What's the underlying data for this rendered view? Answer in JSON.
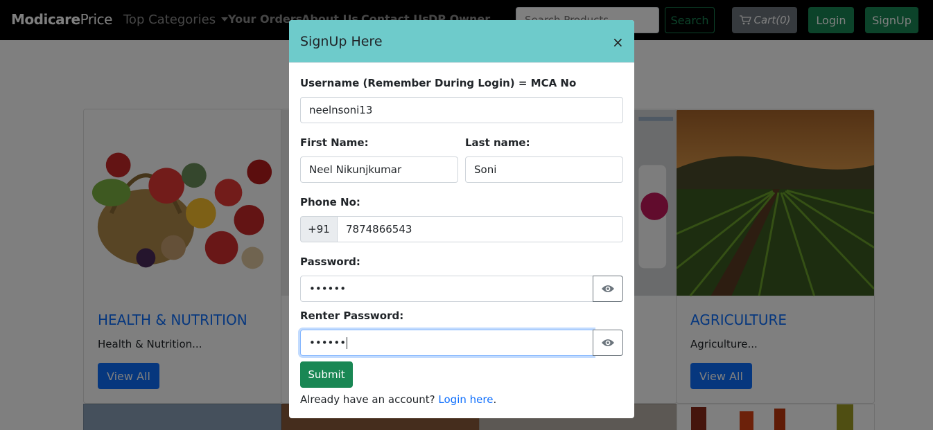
{
  "navbar": {
    "brand_bold": "Modicare",
    "brand_rest": "Price",
    "top_categories": "Top Categories",
    "links": [
      "Your Orders",
      "About Us",
      "Contact Us",
      "DP Owner"
    ],
    "search_placeholder": "Search Products",
    "search_button": "Search",
    "cart_label": "Cart(0)",
    "login_button": "Login",
    "signup_button": "SignUp"
  },
  "cards": [
    {
      "title": "HEALTH & NUTRITION",
      "text": "Health & Nutrition...",
      "button": "View All"
    },
    {
      "title": "AGRICULTURE",
      "text": "Agriculture...",
      "button": "View All"
    }
  ],
  "modal": {
    "title": "SignUp Here",
    "close": "×",
    "username_label": "Username (Remember During Login) = MCA No",
    "username_value": "neelnsoni13",
    "first_name_label": "First Name:",
    "first_name_value": "Neel Nikunjkumar",
    "last_name_label": "Last name:",
    "last_name_value": "Soni",
    "phone_label": "Phone No:",
    "phone_prefix": "+91",
    "phone_value": "7874866543",
    "password_label": "Password:",
    "password_value": "••••••",
    "renter_label": "Renter Password:",
    "renter_value": "••••••",
    "submit": "Submit",
    "already_text": "Already have an account?",
    "login_link": "Login here",
    "period": "."
  },
  "colors": {
    "header_bg": "#6ecbcb",
    "primary": "#0d6efd",
    "success": "#198754"
  }
}
